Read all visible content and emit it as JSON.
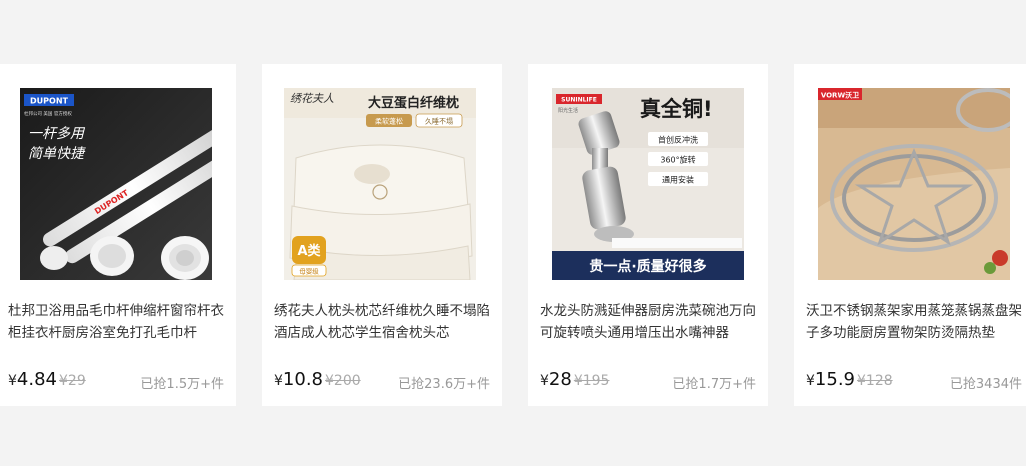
{
  "currency_symbol": "¥",
  "products": [
    {
      "title": "杜邦卫浴用品毛巾杆伸缩杆窗帘杆衣柜挂衣杆厨房浴室免打孔毛巾杆",
      "price": "4.84",
      "original_price": "¥29",
      "sold": "已抢1.5万+件",
      "image": {
        "brand": "DUPONT",
        "brand_sub": "杜邦公司 美国 官方授权",
        "slogan_1": "一杆多用",
        "slogan_2": "简单快捷",
        "rod_label": "DUPONT"
      }
    },
    {
      "title": "绣花夫人枕头枕芯纤维枕久睡不塌陷酒店成人枕芯学生宿舍枕头芯",
      "price": "10.8",
      "original_price": "¥200",
      "sold": "已抢23.6万+件",
      "image": {
        "brand": "绣花夫人",
        "headline": "大豆蛋白纤维枕",
        "tag_1": "柔软蓬松",
        "tag_2": "久睡不塌",
        "grade": "A类",
        "grade_sub": "母婴级"
      }
    },
    {
      "title": "水龙头防溅延伸器厨房洗菜碗池万向可旋转喷头通用增压出水嘴神器",
      "price": "28",
      "original_price": "¥195",
      "sold": "已抢1.7万+件",
      "image": {
        "brand": "SUNINLIFE",
        "brand_sub": "阳光生活",
        "headline": "真全铜!",
        "feature_1": "首创反冲洗",
        "feature_2": "360°旋转",
        "feature_3": "通用安装",
        "banner": "贵一点·质量好很多"
      }
    },
    {
      "title": "沃卫不锈钢蒸架家用蒸笼蒸锅蒸盘架子多功能厨房置物架防烫隔热垫",
      "price": "15.9",
      "original_price": "¥128",
      "sold": "已抢3434件",
      "image": {
        "brand": "VORW沃卫"
      }
    }
  ]
}
